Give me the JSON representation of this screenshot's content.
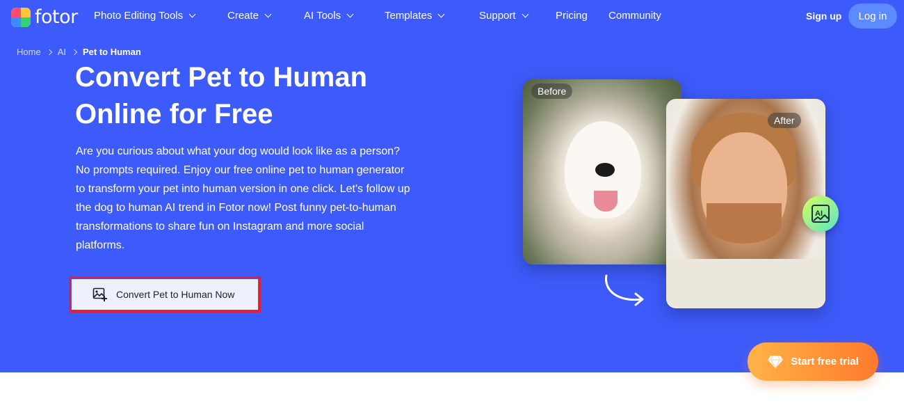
{
  "brand": {
    "name": "fotor"
  },
  "nav": {
    "items": [
      {
        "label": "Photo Editing Tools",
        "dropdown": true
      },
      {
        "label": "Create",
        "dropdown": true
      },
      {
        "label": "AI Tools",
        "dropdown": true
      },
      {
        "label": "Templates",
        "dropdown": true
      },
      {
        "label": "Support",
        "dropdown": true
      },
      {
        "label": "Pricing",
        "dropdown": false
      },
      {
        "label": "Community",
        "dropdown": false
      }
    ],
    "signup_label": "Sign up",
    "login_label": "Log in"
  },
  "breadcrumb": {
    "home": "Home",
    "ai": "AI",
    "current": "Pet to Human"
  },
  "hero": {
    "title_line1": "Convert Pet to Human",
    "title_line2": "Online for Free",
    "description_lines": [
      "Are you curious about what your dog would look like as a person?",
      "No prompts required. Enjoy our free online pet to human generator",
      "to transform your pet into human version in one click. Let's follow up",
      "the dog to human AI trend in Fotor now! Post funny pet-to-human",
      "transformations to share fun on Instagram and more social",
      "platforms."
    ],
    "cta_label": "Convert Pet to Human Now"
  },
  "images": {
    "before_label": "Before",
    "after_label": "After"
  },
  "trial": {
    "label": "Start free trial"
  },
  "colors": {
    "hero_bg": "#3d5afa",
    "login_bg": "#5d8bff",
    "cta_highlight": "#e0203a",
    "trial_start": "#ffb347",
    "trial_end": "#ff7a2e"
  },
  "icons": [
    "fotor-logo",
    "chevron-down-icon",
    "chevron-right-icon",
    "image-add-icon",
    "ai-image-icon",
    "curved-arrow-icon",
    "diamond-icon"
  ]
}
